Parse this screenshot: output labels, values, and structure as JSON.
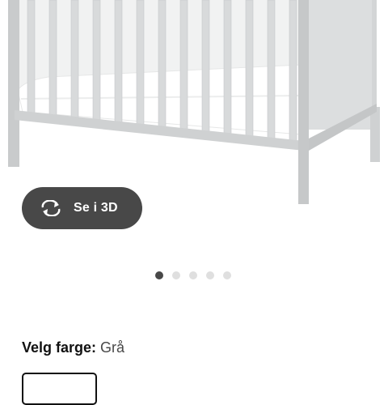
{
  "product_image": {
    "alt_icon": "crib-image"
  },
  "view_3d": {
    "label": "Se i 3D",
    "icon": "rotate-3d-icon"
  },
  "carousel": {
    "count": 5,
    "active_index": 0
  },
  "color": {
    "label": "Velg farge:",
    "value": "Grå"
  },
  "colors": {
    "accent_dark": "#484848",
    "frame": "#d6d8d9",
    "mattress": "#ffffff"
  }
}
